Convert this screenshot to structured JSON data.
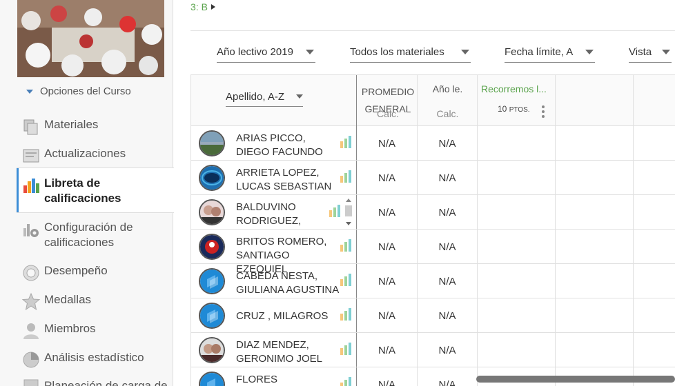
{
  "breadcrumb": {
    "text": "3: B"
  },
  "sidebar": {
    "options_label": "Opciones del Curso",
    "items": [
      {
        "label": "Materiales",
        "icon": "materials-icon"
      },
      {
        "label": "Actualizaciones",
        "icon": "updates-icon"
      },
      {
        "label": "Libreta de calificaciones",
        "icon": "gradebook-icon",
        "active": true
      },
      {
        "label": "Configuración de calificaciones",
        "icon": "grade-settings-icon"
      },
      {
        "label": "Desempeño",
        "icon": "performance-icon"
      },
      {
        "label": "Medallas",
        "icon": "badges-icon"
      },
      {
        "label": "Miembros",
        "icon": "members-icon"
      },
      {
        "label": "Análisis estadístico",
        "icon": "analytics-icon"
      },
      {
        "label": "Planeación de carga de",
        "icon": "planning-icon"
      }
    ]
  },
  "filters": {
    "year": "Año lectivo 2019",
    "materials": "Todos los materiales",
    "sort_due": "Fecha límite, A",
    "view": "Vista"
  },
  "grid": {
    "sort_label": "Apellido, A-Z",
    "col_promedio": "PROMEDIO GENERAL",
    "col_promedio_sub": "Calc.",
    "col_year": "Año le.",
    "col_year_sub": "Calc.",
    "assignment_title": "Recorremos l...",
    "assignment_points": "10",
    "assignment_points_unit": "PTOS.",
    "students": [
      {
        "name": "ARIAS PICCO, DIEGO FACUNDO",
        "avg": "N/A",
        "year": "N/A"
      },
      {
        "name": "ARRIETA LOPEZ, LUCAS SEBASTIAN",
        "avg": "N/A",
        "year": "N/A"
      },
      {
        "name": "BALDUVINO RODRIGUEZ,",
        "avg": "N/A",
        "year": "N/A"
      },
      {
        "name": "BRITOS ROMERO, SANTIAGO EZEQUIEL",
        "avg": "N/A",
        "year": "N/A"
      },
      {
        "name": "CABEDA NESTA, GIULIANA AGUSTINA",
        "avg": "N/A",
        "year": "N/A"
      },
      {
        "name": "CRUZ , MILAGROS",
        "avg": "N/A",
        "year": "N/A"
      },
      {
        "name": "DIAZ MENDEZ, GERONIMO JOEL",
        "avg": "N/A",
        "year": "N/A"
      },
      {
        "name": "FLORES FIGUEREDO,",
        "avg": "N/A",
        "year": "N/A"
      }
    ]
  },
  "colors": {
    "accent_green": "#5aa34c",
    "active_blue": "#3c8dd6"
  }
}
